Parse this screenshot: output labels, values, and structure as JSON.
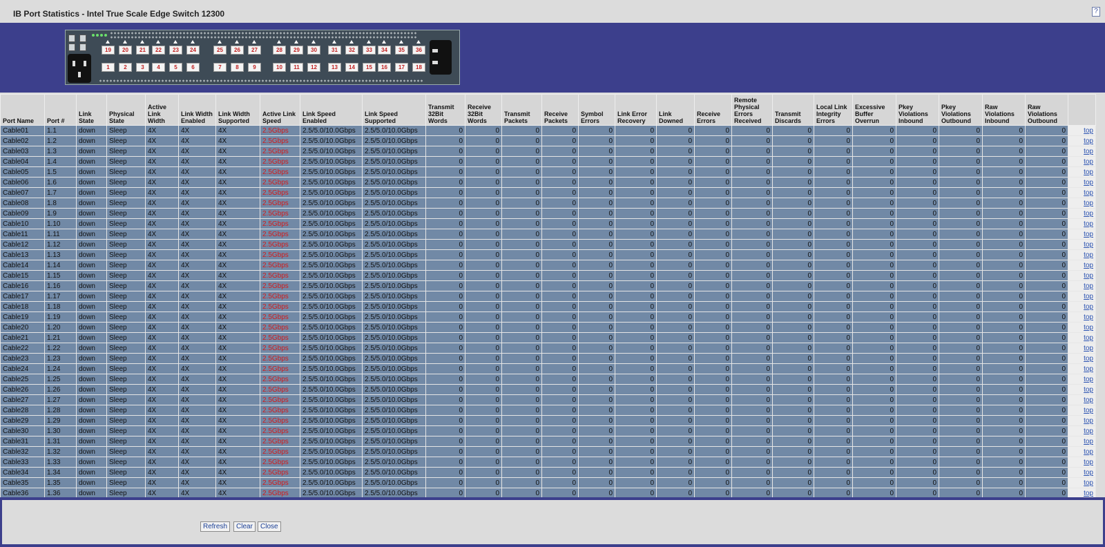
{
  "window": {
    "title": "IB Port Statistics - Intel True Scale Edge Switch 12300",
    "help_label": "?"
  },
  "switch_image": {
    "top_ports": [
      "19",
      "20",
      "21",
      "22",
      "23",
      "24",
      "25",
      "26",
      "27",
      "28",
      "29",
      "30",
      "31",
      "32",
      "33",
      "34",
      "35",
      "36"
    ],
    "bottom_ports": [
      "1",
      "2",
      "3",
      "4",
      "5",
      "6",
      "7",
      "8",
      "9",
      "10",
      "11",
      "12",
      "13",
      "14",
      "15",
      "16",
      "17",
      "18"
    ]
  },
  "table": {
    "columns": [
      "Port Name",
      "Port #",
      "Link State",
      "Physical State",
      "Active Link Width",
      "Link Width Enabled",
      "Link Width Supported",
      "Active Link Speed",
      "Link Speed Enabled",
      "Link Speed Supported",
      "Transmit 32Bit Words",
      "Receive 32Bit Words",
      "Transmit Packets",
      "Receive Packets",
      "Symbol Errors",
      "Link Error Recovery",
      "Link Downed",
      "Receive Errors",
      "Remote Physical Errors Received",
      "Transmit Discards",
      "Local Link Integrity Errors",
      "Excessive Buffer Overrun",
      "Pkey Violations Inbound",
      "Pkey Violations Outbound",
      "Raw Violations Inbound",
      "Raw Violations Outbound"
    ],
    "link_state": "down",
    "physical_state": "Sleep",
    "active_link_width": "4X",
    "link_width_enabled": "4X",
    "link_width_supported": "4X",
    "active_link_speed": "2.5Gbps",
    "link_speed_enabled": "2.5/5.0/10.0Gbps",
    "link_speed_supported": "2.5/5.0/10.0Gbps",
    "counter_value": "0",
    "top_link": "top",
    "rows": [
      {
        "name": "Cable01",
        "port": "1.1"
      },
      {
        "name": "Cable02",
        "port": "1.2"
      },
      {
        "name": "Cable03",
        "port": "1.3"
      },
      {
        "name": "Cable04",
        "port": "1.4"
      },
      {
        "name": "Cable05",
        "port": "1.5"
      },
      {
        "name": "Cable06",
        "port": "1.6"
      },
      {
        "name": "Cable07",
        "port": "1.7"
      },
      {
        "name": "Cable08",
        "port": "1.8"
      },
      {
        "name": "Cable09",
        "port": "1.9"
      },
      {
        "name": "Cable10",
        "port": "1.10"
      },
      {
        "name": "Cable11",
        "port": "1.11"
      },
      {
        "name": "Cable12",
        "port": "1.12"
      },
      {
        "name": "Cable13",
        "port": "1.13"
      },
      {
        "name": "Cable14",
        "port": "1.14"
      },
      {
        "name": "Cable15",
        "port": "1.15"
      },
      {
        "name": "Cable16",
        "port": "1.16"
      },
      {
        "name": "Cable17",
        "port": "1.17"
      },
      {
        "name": "Cable18",
        "port": "1.18"
      },
      {
        "name": "Cable19",
        "port": "1.19"
      },
      {
        "name": "Cable20",
        "port": "1.20"
      },
      {
        "name": "Cable21",
        "port": "1.21"
      },
      {
        "name": "Cable22",
        "port": "1.22"
      },
      {
        "name": "Cable23",
        "port": "1.23"
      },
      {
        "name": "Cable24",
        "port": "1.24"
      },
      {
        "name": "Cable25",
        "port": "1.25"
      },
      {
        "name": "Cable26",
        "port": "1.26"
      },
      {
        "name": "Cable27",
        "port": "1.27"
      },
      {
        "name": "Cable28",
        "port": "1.28"
      },
      {
        "name": "Cable29",
        "port": "1.29"
      },
      {
        "name": "Cable30",
        "port": "1.30"
      },
      {
        "name": "Cable31",
        "port": "1.31"
      },
      {
        "name": "Cable32",
        "port": "1.32"
      },
      {
        "name": "Cable33",
        "port": "1.33"
      },
      {
        "name": "Cable34",
        "port": "1.34"
      },
      {
        "name": "Cable35",
        "port": "1.35"
      },
      {
        "name": "Cable36",
        "port": "1.36"
      }
    ]
  },
  "footer": {
    "refresh_label": "Refresh",
    "clear_label": "Clear",
    "close_label": "Close"
  },
  "colors": {
    "banner": "#3c3f8c",
    "row_bg": "#7189a6",
    "speed_red": "#d21a1a",
    "port_label_red": "#c02020"
  }
}
